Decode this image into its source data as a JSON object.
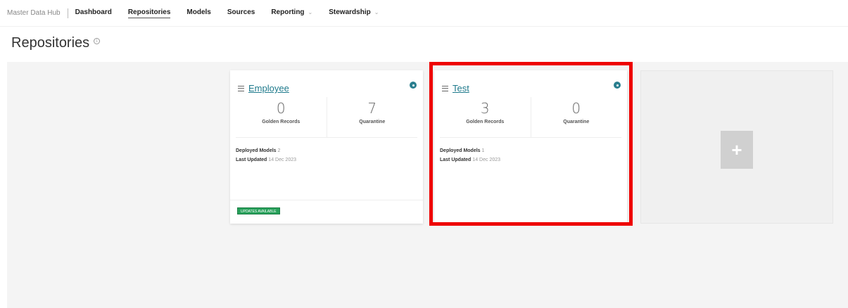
{
  "nav": {
    "app_title": "Master Data Hub",
    "items": [
      {
        "label": "Dashboard",
        "dropdown": false
      },
      {
        "label": "Repositories",
        "dropdown": false,
        "active": true
      },
      {
        "label": "Models",
        "dropdown": false
      },
      {
        "label": "Sources",
        "dropdown": false
      },
      {
        "label": "Reporting",
        "dropdown": true
      },
      {
        "label": "Stewardship",
        "dropdown": true
      }
    ]
  },
  "page": {
    "title": "Repositories",
    "info_icon": "info-icon"
  },
  "cards": [
    {
      "title": "Employee",
      "golden_records": "0",
      "golden_records_label": "Golden Records",
      "quarantine": "7",
      "quarantine_label": "Quarantine",
      "deployed_models_label": "Deployed Models",
      "deployed_models": "2",
      "last_updated_label": "Last Updated",
      "last_updated": "14 Dec 2023",
      "badge": "UPDATES AVAILABLE"
    },
    {
      "title": "Test",
      "golden_records": "3",
      "golden_records_label": "Golden Records",
      "quarantine": "0",
      "quarantine_label": "Quarantine",
      "deployed_models_label": "Deployed Models",
      "deployed_models": "1",
      "last_updated_label": "Last Updated",
      "last_updated": "14 Dec 2023"
    }
  ],
  "add_card": {
    "icon": "plus-icon",
    "symbol": "+"
  },
  "colors": {
    "accent": "#1f7a8c",
    "badge": "#27a05a",
    "highlight": "#ee0000"
  }
}
